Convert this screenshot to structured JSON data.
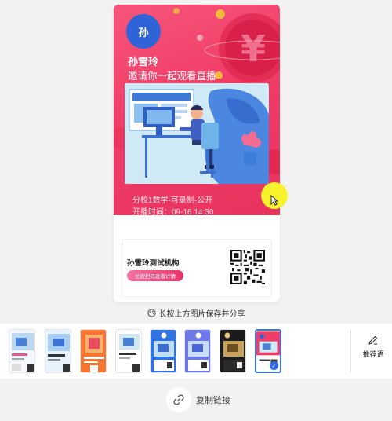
{
  "poster": {
    "avatar_text": "孙",
    "host_name": "孙雪玲",
    "invite_text": "邀请你一起观看直播",
    "course_title": "分校1数学-可录制-公开",
    "start_time": "开播时间：09-16 14:30",
    "org_name": "孙雪玲测试机构",
    "detail_button": "长按扫码查看详情",
    "currency_symbol": "¥"
  },
  "hint": {
    "text": "长按上方图片保存并分享"
  },
  "templates": {
    "selected_index": 7,
    "items": [
      {
        "name": "template-1",
        "style": "light-blue"
      },
      {
        "name": "template-2",
        "style": "light-blue-2"
      },
      {
        "name": "template-3",
        "style": "orange"
      },
      {
        "name": "template-4",
        "style": "white"
      },
      {
        "name": "template-5",
        "style": "blue"
      },
      {
        "name": "template-6",
        "style": "purple-blue"
      },
      {
        "name": "template-7",
        "style": "black-gold"
      },
      {
        "name": "template-8",
        "style": "pink-red"
      }
    ]
  },
  "recommend": {
    "label": "推荐语"
  },
  "copy_link": {
    "label": "复制链接"
  },
  "colors": {
    "poster_pink": "#f03d68",
    "avatar_blue": "#2f63d8",
    "accent_blue": "#3b76e8",
    "touch_yellow": "#f8f22c"
  }
}
